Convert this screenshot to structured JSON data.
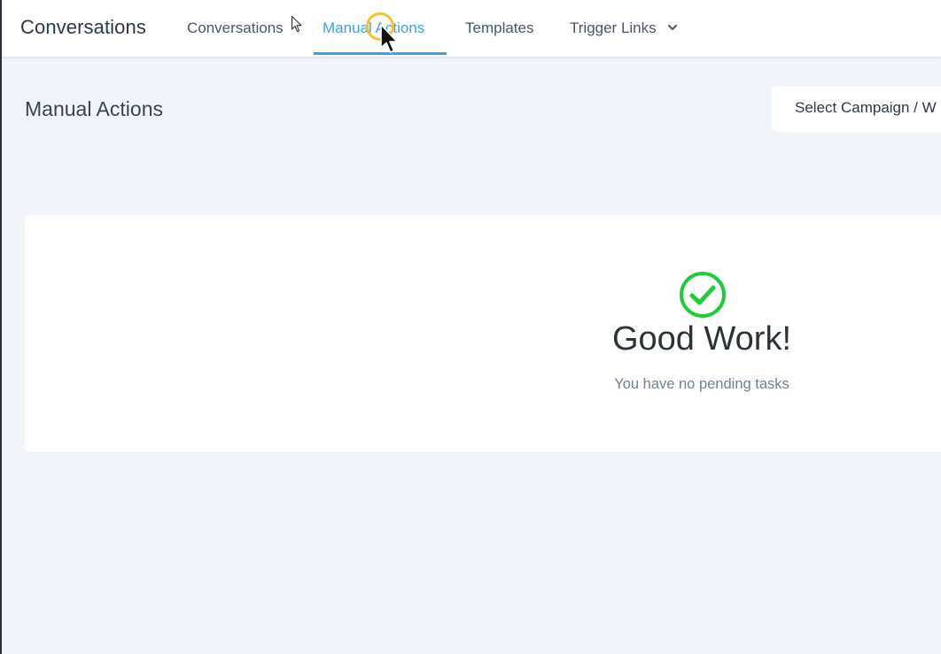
{
  "header": {
    "app_title": "Conversations",
    "tabs": [
      {
        "label": "Conversations",
        "active": false
      },
      {
        "label": "Manual Actions",
        "active": true
      },
      {
        "label": "Templates",
        "active": false
      },
      {
        "label": "Trigger Links",
        "active": false,
        "has_dropdown": true
      }
    ]
  },
  "main": {
    "page_title": "Manual Actions",
    "campaign_select": {
      "value": "Select Campaign / W"
    },
    "empty_state": {
      "icon": "check-circle-icon",
      "title": "Good Work!",
      "message": "You have no pending tasks"
    }
  },
  "colors": {
    "accent": "#3aa3e8",
    "success": "#1fcc35",
    "background": "#f1f5f9",
    "cursor_highlight": "#f1c232"
  }
}
